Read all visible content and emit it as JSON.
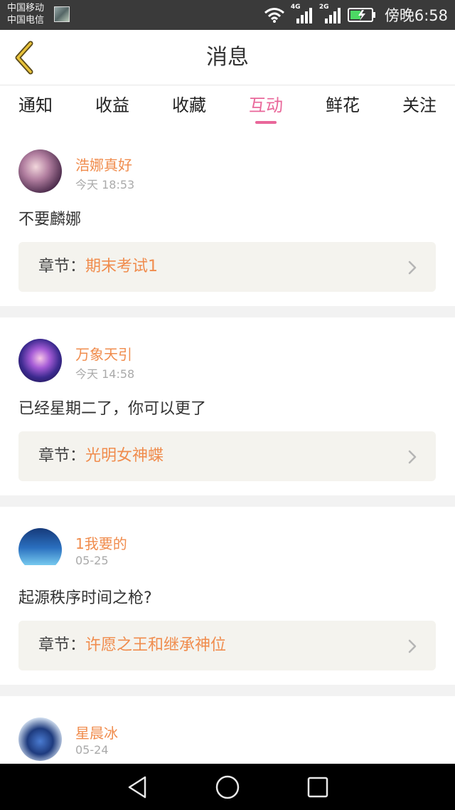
{
  "status_bar": {
    "carrier_1": "中国移动",
    "carrier_2": "中国电信",
    "network_1": "4G",
    "network_2": "2G",
    "time": "傍晚6:58"
  },
  "header": {
    "title": "消息"
  },
  "tabs": [
    {
      "label": "通知"
    },
    {
      "label": "收益"
    },
    {
      "label": "收藏"
    },
    {
      "label": "互动",
      "active": true
    },
    {
      "label": "鲜花"
    },
    {
      "label": "关注"
    }
  ],
  "chapter_prefix": "章节：",
  "messages": [
    {
      "username": "浩娜真好",
      "time": "今天 18:53",
      "text": "不要麟娜",
      "chapter": "期末考试1"
    },
    {
      "username": "万象天引",
      "time": "今天 14:58",
      "text": "已经星期二了，你可以更了",
      "chapter": "光明女神蝶"
    },
    {
      "username": "1我要的",
      "time": "05-25",
      "text": "起源秩序时间之枪?",
      "chapter": "许愿之王和继承神位"
    },
    {
      "username": "星晨冰",
      "time": "05-24"
    }
  ],
  "colors": {
    "accent": "#e9679a",
    "username": "#f08c4d",
    "back_arrow": "#e8c23a"
  }
}
